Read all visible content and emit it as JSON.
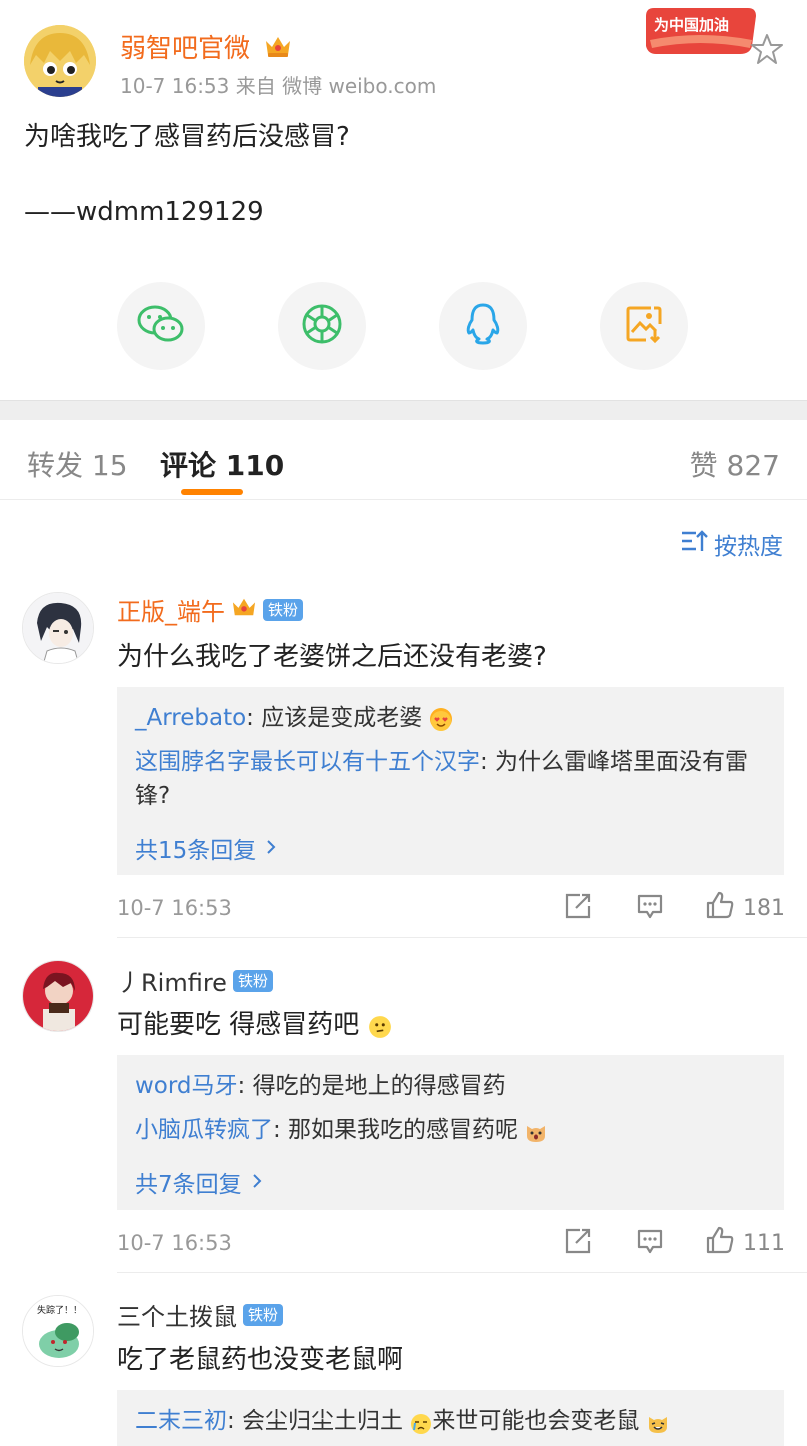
{
  "post": {
    "author": "弱智吧官微",
    "meta": "10-7 16:53   来自 微博 weibo.com",
    "badge_event_text": "为中国加油",
    "text": "为啥我吃了感冒药后没感冒?",
    "signature": "——wdmm129129",
    "share_icons": [
      "wechat-icon",
      "moments-icon",
      "qq-icon",
      "save-image-icon"
    ],
    "accent_color": "#f26b1d"
  },
  "tabs": {
    "repost": "转发 15",
    "comments": "评论 110",
    "likes": "赞 827"
  },
  "sort": {
    "label": "按热度"
  },
  "comments": [
    {
      "user": "正版_端午",
      "badge": "铁粉",
      "text": "为什么我吃了老婆饼之后还没有老婆?",
      "replies": [
        {
          "user": "_Arrebato",
          "text": ": 应该是变成老婆"
        },
        {
          "user": "这围脖名字最长可以有十五个汉字",
          "text": ": 为什么雷峰塔里面没有雷锋?"
        }
      ],
      "more": "共15条回复",
      "time": "10-7 16:53",
      "likes": "181"
    },
    {
      "user": "丿Rimfire",
      "badge": "铁粉",
      "text": "可能要吃 得感冒药吧",
      "replies": [
        {
          "user": "word马牙",
          "text": ": 得吃的是地上的得感冒药"
        },
        {
          "user": "小脑瓜转疯了",
          "text": ": 那如果我吃的感冒药呢"
        }
      ],
      "more": "共7条回复",
      "time": "10-7 16:53",
      "likes": "111"
    },
    {
      "user": "三个土拨鼠",
      "badge": "铁粉",
      "avatar_text": "失踪了！！",
      "text": "吃了老鼠药也没变老鼠啊",
      "replies": [
        {
          "user": "二末三初",
          "text": ": 会尘归尘土归土"
        },
        {
          "user": "",
          "text": "来世可能也会变老鼠"
        }
      ]
    }
  ]
}
